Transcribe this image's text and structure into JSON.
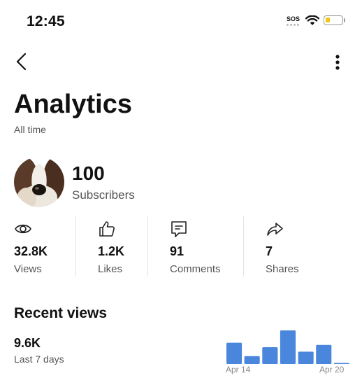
{
  "status_bar": {
    "time": "12:45",
    "sos": "SOS"
  },
  "header": {
    "title": "Analytics",
    "subtitle": "All time"
  },
  "profile": {
    "subscriber_count": "100",
    "subscriber_label": "Subscribers"
  },
  "stats": [
    {
      "icon": "eye-icon",
      "value": "32.8K",
      "label": "Views"
    },
    {
      "icon": "thumbs-up-icon",
      "value": "1.2K",
      "label": "Likes"
    },
    {
      "icon": "comment-icon",
      "value": "91",
      "label": "Comments"
    },
    {
      "icon": "share-icon",
      "value": "7",
      "label": "Shares"
    }
  ],
  "recent": {
    "title": "Recent views",
    "value": "9.6K",
    "label": "Last 7 days"
  },
  "chart_data": {
    "type": "bar",
    "start_label": "Apr 14",
    "end_label": "Apr 20",
    "values": [
      1.9,
      0.7,
      1.5,
      3.0,
      1.1,
      1.7,
      0.05
    ],
    "color": "#4a86dc"
  },
  "colors": {
    "accent": "#4a86dc",
    "battery": "#f0c419"
  }
}
